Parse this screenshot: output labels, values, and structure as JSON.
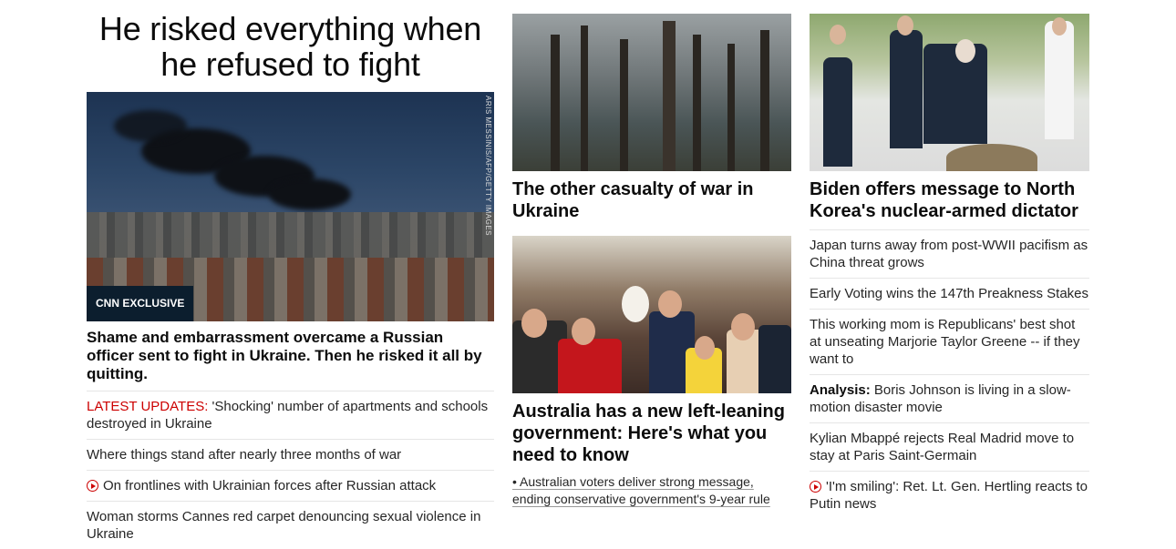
{
  "col1": {
    "headline": "He risked everything when he refused to fight",
    "image_credit": "ARIS MESSINIS/AFP/GETTY IMAGES",
    "badge": "CNN EXCLUSIVE",
    "lead_text": "Shame and embarrassment overcame a Russian officer sent to fight in Ukraine. Then he risked it all by quitting.",
    "items": [
      {
        "prefix": "LATEST UPDATES:",
        "text": " 'Shocking' number of apartments and schools destroyed in Ukraine"
      },
      {
        "text": "Where things stand after nearly three months of war"
      },
      {
        "text": "On frontlines with Ukrainian forces after Russian attack",
        "video": true
      },
      {
        "text": "Woman storms Cannes red carpet denouncing sexual violence in Ukraine"
      }
    ]
  },
  "col2": {
    "card1_title": "The other casualty of war in Ukraine",
    "card2_title": "Australia has a new left-leaning government: Here's what you need to know",
    "card2_link": "• Australian voters deliver strong message, ending conservative government's 9-year rule"
  },
  "col3": {
    "title": "Biden offers message to North Korea's nuclear-armed dictator",
    "items": [
      {
        "text": "Japan turns away from post-WWII pacifism as China threat grows"
      },
      {
        "text": "Early Voting wins the 147th Preakness Stakes"
      },
      {
        "text": "This working mom is Republicans' best shot at unseating Marjorie Taylor Greene -- if they want to"
      },
      {
        "prefix": "Analysis:",
        "text": " Boris Johnson is living in a slow-motion disaster movie"
      },
      {
        "text": "Kylian Mbappé rejects Real Madrid move to stay at Paris Saint-Germain"
      },
      {
        "text": "'I'm smiling': Ret. Lt. Gen. Hertling reacts to Putin news",
        "video": true
      }
    ]
  },
  "colors": {
    "accent_red": "#cc0000",
    "badge_bg": "#0c1e2e"
  }
}
